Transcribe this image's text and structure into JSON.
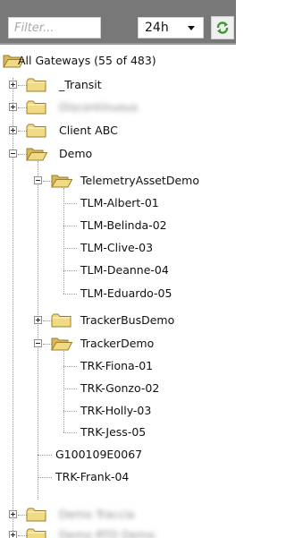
{
  "toolbar": {
    "filter_placeholder": "Filter...",
    "range_value": "24h",
    "refresh_icon": "refresh-icon"
  },
  "tree": {
    "root": "All Gateways (55 of 483)",
    "n_transit": "_Transit",
    "n_blur1": "Discontinuous",
    "n_client_abc": "Client ABC",
    "n_demo": "Demo",
    "n_tad": "TelemetryAssetDemo",
    "n_tlm1": "TLM-Albert-01",
    "n_tlm2": "TLM-Belinda-02",
    "n_tlm3": "TLM-Clive-03",
    "n_tlm4": "TLM-Deanne-04",
    "n_tlm5": "TLM-Eduardo-05",
    "n_tbd": "TrackerBusDemo",
    "n_td": "TrackerDemo",
    "n_trk1": "TRK-Fiona-01",
    "n_trk2": "TRK-Gonzo-02",
    "n_trk3": "TRK-Holly-03",
    "n_trk4": "TRK-Jess-05",
    "n_g1": "G100109E0067",
    "n_frank": "TRK-Frank-04",
    "n_blur2": "Demo Traccia",
    "n_blur3": "Demo RTD Demo"
  },
  "colors": {
    "toolbar_bg": "#787878",
    "folder_fill": "#f1da84",
    "folder_stroke": "#9a7c2c",
    "refresh_green": "#3a9a2b"
  }
}
